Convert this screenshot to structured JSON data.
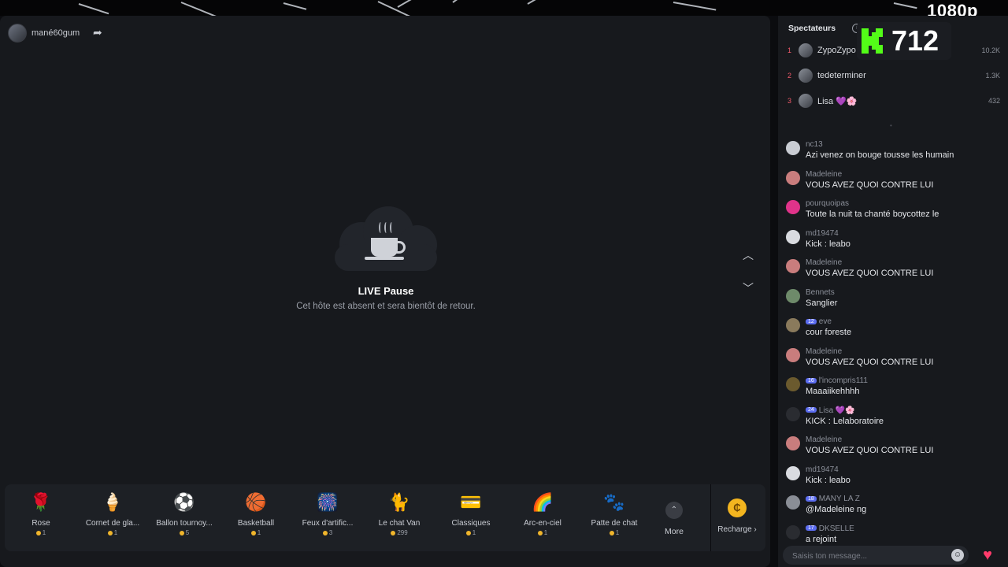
{
  "overlay": {
    "resolution": "1080p"
  },
  "host": {
    "name": "mané60gum"
  },
  "pause": {
    "title": "LIVE Pause",
    "subtitle": "Cet hôte est absent et sera bientôt de retour."
  },
  "gifts": [
    {
      "name": "Rose",
      "price": "1",
      "icon": "🌹"
    },
    {
      "name": "Cornet de gla...",
      "price": "1",
      "icon": "🍦"
    },
    {
      "name": "Ballon tournoy...",
      "price": "5",
      "icon": "⚽"
    },
    {
      "name": "Basketball",
      "price": "1",
      "icon": "🏀"
    },
    {
      "name": "Feux d'artific...",
      "price": "3",
      "icon": "🎆"
    },
    {
      "name": "Le chat Van",
      "price": "299",
      "icon": "🐈"
    },
    {
      "name": "Classiques",
      "price": "1",
      "icon": "💳"
    },
    {
      "name": "Arc-en-ciel",
      "price": "1",
      "icon": "🌈"
    },
    {
      "name": "Patte de chat",
      "price": "1",
      "icon": "🐾"
    }
  ],
  "gift_bar": {
    "more_label": "More",
    "recharge_label": "Recharge ›"
  },
  "viewers": {
    "title": "Spectateurs",
    "count": "712",
    "top": [
      {
        "rank": "1",
        "name": "ZypoZypo",
        "score": "10.2K"
      },
      {
        "rank": "2",
        "name": "tedeterminer",
        "score": "1.3K"
      },
      {
        "rank": "3",
        "name": "Lisa 💜🌸",
        "score": "432"
      }
    ]
  },
  "chat": {
    "messages": [
      {
        "user": "nc13",
        "text": "Azi venez on bouge tousse les humain",
        "avatar": "#c9ccd3"
      },
      {
        "user": "Madeleine",
        "text": "VOUS AVEZ QUOI CONTRE LUI",
        "avatar": "#c97d7d"
      },
      {
        "user": "pourquoipas",
        "text": "Toute la nuit ta chanté boycottez le",
        "avatar": "#e0338a"
      },
      {
        "user": "md19474",
        "text": "Kick : leabo",
        "avatar": "#d9dbe0"
      },
      {
        "user": "Madeleine",
        "text": "VOUS AVEZ QUOI CONTRE LUI",
        "avatar": "#c97d7d"
      },
      {
        "user": "Bennets",
        "text": "Sanglier",
        "avatar": "#6e8a6a"
      },
      {
        "user": "eve",
        "badge": "12",
        "text": "cour foreste",
        "avatar": "#8a7a5c"
      },
      {
        "user": "Madeleine",
        "text": "VOUS AVEZ QUOI CONTRE LUI",
        "avatar": "#c97d7d"
      },
      {
        "user": "l'incompris111",
        "badge": "16",
        "text": "Maaaiikehhhh",
        "avatar": "#6b5a2e"
      },
      {
        "user": "Lisa 💜🌸",
        "badge": "24",
        "text": "KICK : Lelaboratoire",
        "avatar": "#2a2c31"
      },
      {
        "user": "Madeleine",
        "text": "VOUS AVEZ QUOI CONTRE LUI",
        "avatar": "#c97d7d"
      },
      {
        "user": "md19474",
        "text": "Kick : leabo",
        "avatar": "#d9dbe0"
      },
      {
        "user": "MANY LA Z",
        "badge": "18",
        "text": "@Madeleine ng",
        "avatar": "#8a8e96"
      },
      {
        "user": "DKSELLE",
        "badge": "17",
        "text": "a rejoint",
        "avatar": "#2a2c31"
      }
    ],
    "input_placeholder": "Saisis ton message..."
  },
  "colors": {
    "kick_green": "#53fc18",
    "coin": "#f3b51f",
    "like": "#ff3b6b",
    "rank": "#f25a6b"
  }
}
